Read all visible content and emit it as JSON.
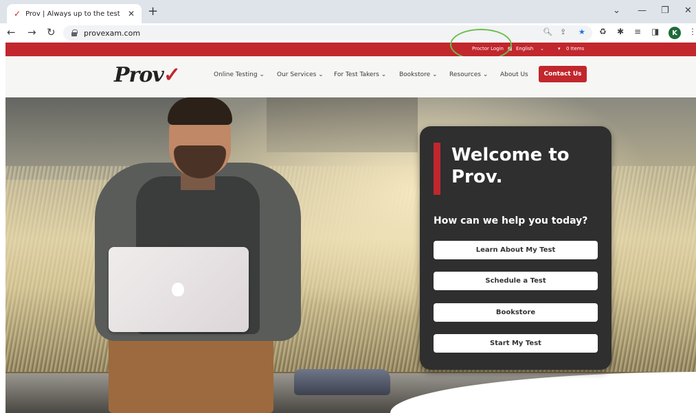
{
  "browser": {
    "tab_title": "Prov | Always up to the test",
    "tab_favicon": "✓",
    "url": "provexam.com",
    "profile_initial": "K"
  },
  "site": {
    "topbar": {
      "proctor_login": "Proctor Login",
      "language": "English",
      "cart": "0 Items"
    },
    "logo_text": "Prov",
    "logo_mark": "✓",
    "nav": [
      {
        "label": "Online Testing"
      },
      {
        "label": "Our Services"
      },
      {
        "label": "For Test Takers"
      },
      {
        "label": "Bookstore"
      },
      {
        "label": "Resources"
      },
      {
        "label": "About Us"
      }
    ],
    "contact_label": "Contact Us",
    "brand_color": "#c1272d"
  },
  "hero": {
    "heading": "Welcome to Prov.",
    "question": "How can we help you today?",
    "buttons": [
      {
        "label": "Learn About My Test"
      },
      {
        "label": "Schedule a Test"
      },
      {
        "label": "Bookstore"
      },
      {
        "label": "Start My Test"
      }
    ]
  }
}
